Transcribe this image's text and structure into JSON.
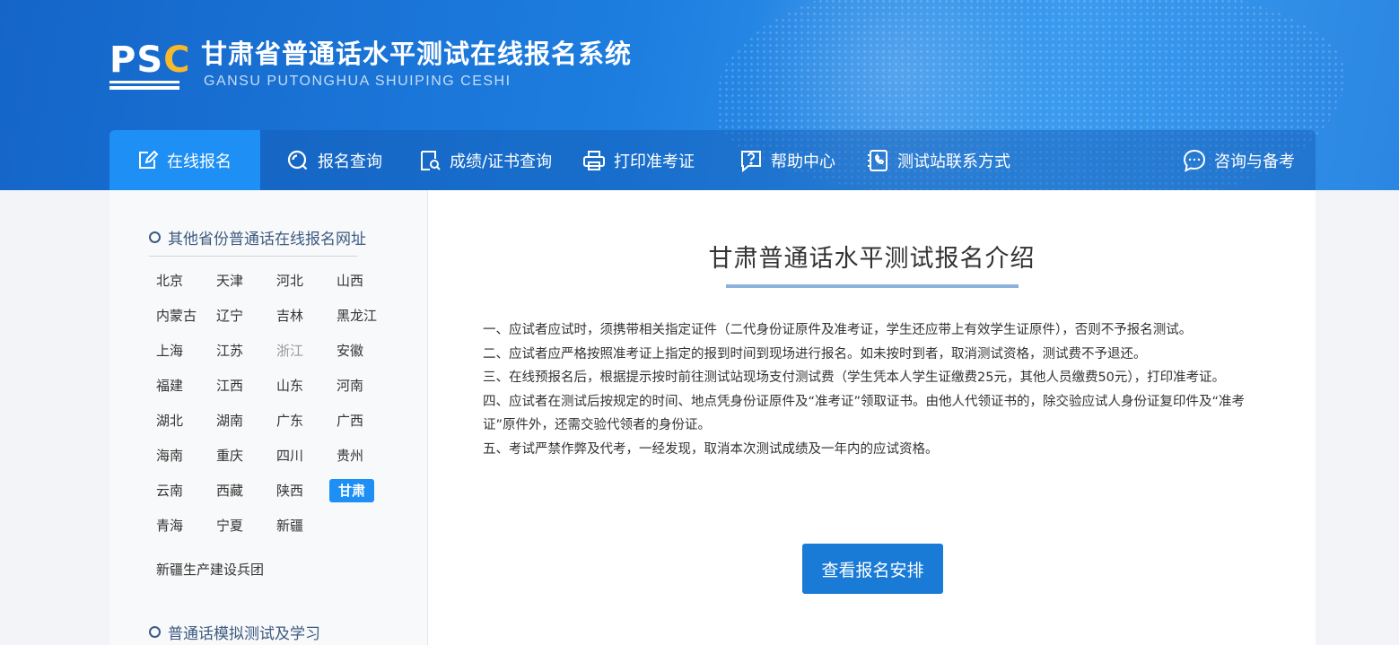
{
  "header": {
    "logo": {
      "letters_left": "PS",
      "letter_accent": "C",
      "accent_color": "#f6b92b"
    },
    "title": "甘肃省普通话水平测试在线报名系统",
    "subtitle": "GANSU PUTONGHUA SHUIPING CESHI"
  },
  "nav": {
    "items": [
      {
        "label": "在线报名",
        "icon": "edit-icon",
        "active": true
      },
      {
        "label": "报名查询",
        "icon": "search-icon"
      },
      {
        "label": "成绩/证书查询",
        "icon": "document-search-icon"
      },
      {
        "label": "打印准考证",
        "icon": "printer-icon"
      },
      {
        "label": "帮助中心",
        "icon": "help-icon"
      },
      {
        "label": "测试站联系方式",
        "icon": "phone-contact-icon"
      },
      {
        "label": "咨询与备考",
        "icon": "chat-icon"
      }
    ]
  },
  "sidebar": {
    "heading_provinces": "其他省份普通话在线报名网址",
    "provinces": [
      [
        "北京",
        "天津",
        "河北",
        "山西"
      ],
      [
        "内蒙古",
        "辽宁",
        "吉林",
        "黑龙江"
      ],
      [
        "上海",
        "江苏",
        "浙江",
        "安徽"
      ],
      [
        "福建",
        "江西",
        "山东",
        "河南"
      ],
      [
        "湖北",
        "湖南",
        "广东",
        "广西"
      ],
      [
        "海南",
        "重庆",
        "四川",
        "贵州"
      ],
      [
        "云南",
        "西藏",
        "陕西",
        "甘肃"
      ],
      [
        "青海",
        "宁夏",
        "新疆"
      ]
    ],
    "muted_province": "浙江",
    "active_province": "甘肃",
    "extra_item": "新疆生产建设兵团",
    "heading_practice": "普通话模拟测试及学习"
  },
  "main": {
    "title": "甘肃普通话水平测试报名介绍",
    "rules": [
      "一、应试者应试时，须携带相关指定证件（二代身份证原件及准考证，学生还应带上有效学生证原件），否则不予报名测试。",
      "二、应试者应严格按照准考证上指定的报到时间到现场进行报名。如未按时到者，取消测试资格，测试费不予退还。",
      "三、在线预报名后，根据提示按时前往测试站现场支付测试费（学生凭本人学生证缴费25元，其他人员缴费50元），打印准考证。",
      "四、应试者在测试后按规定的时间、地点凭身份证原件及“准考证”领取证书。由他人代领证书的，除交验应试人身份证复印件及“准考证”原件外，还需交验代领者的身份证。",
      "五、考试严禁作弊及代考，一经发现，取消本次测试成绩及一年内的应试资格。"
    ],
    "button_label": "查看报名安排"
  },
  "colors": {
    "header_blue": "#1d7ee0",
    "active_blue": "#1e8ff5",
    "button_blue": "#1a7bd6",
    "heading_navy": "#3d5a80"
  }
}
